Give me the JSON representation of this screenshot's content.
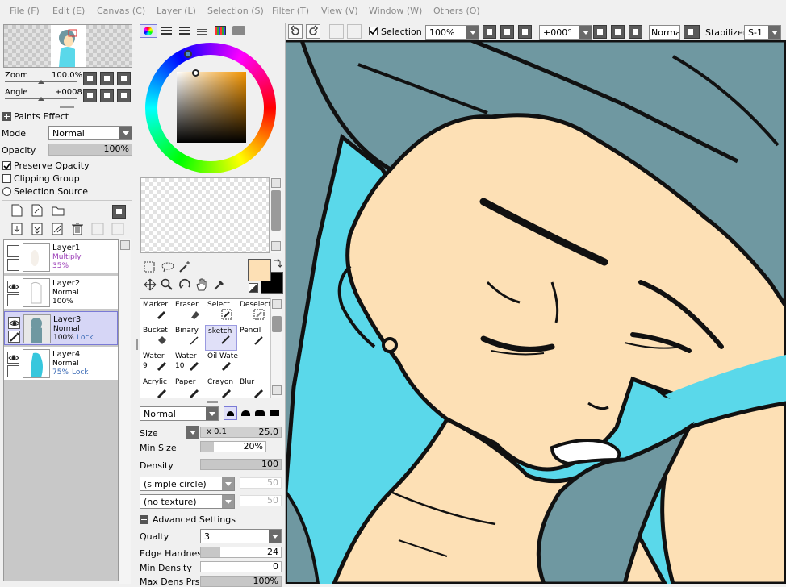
{
  "menu": [
    "File (F)",
    "Edit (E)",
    "Canvas (C)",
    "Layer (L)",
    "Selection (S)",
    "Filter (T)",
    "View (V)",
    "Window (W)",
    "Others (O)"
  ],
  "toolbar": {
    "selection_label": "Selection",
    "selection_checked": true,
    "zoom_value": "100%",
    "angle_value": "+000°",
    "blend_label": "Normal",
    "stabilizer_label": "Stabilizer",
    "stabilizer_value": "S-1"
  },
  "navigator": {
    "zoom_label": "Zoom",
    "zoom_value": "100.0%",
    "angle_label": "Angle",
    "angle_value": "+0008"
  },
  "layer_panel": {
    "paints_effect": "Paints Effect",
    "mode_label": "Mode",
    "mode_value": "Normal",
    "opacity_label": "Opacity",
    "opacity_value": "100%",
    "preserve_opacity": "Preserve Opacity",
    "clipping_group": "Clipping Group",
    "selection_source": "Selection Source",
    "layers": [
      {
        "name": "Layer1",
        "mode": "Multiply",
        "opacity": "35%",
        "lock": "",
        "visible": false,
        "selected": false
      },
      {
        "name": "Layer2",
        "mode": "Normal",
        "opacity": "100%",
        "lock": "",
        "visible": true,
        "selected": false
      },
      {
        "name": "Layer3",
        "mode": "Normal",
        "opacity": "100%",
        "lock": "Lock",
        "visible": true,
        "selected": true
      },
      {
        "name": "Layer4",
        "mode": "Normal",
        "opacity": "75%",
        "lock": "Lock",
        "visible": true,
        "selected": false
      }
    ]
  },
  "colors": {
    "primary": "#fde0b5",
    "secondary": "#000000",
    "canvas_hair": "#6f98a1",
    "canvas_skin": "#fde0b5",
    "canvas_bg": "#5ad8ea"
  },
  "tools": [
    {
      "name": "Marker",
      "num": ""
    },
    {
      "name": "Eraser",
      "num": ""
    },
    {
      "name": "Select",
      "num": ""
    },
    {
      "name": "Deselect",
      "num": ""
    },
    {
      "name": "Bucket",
      "num": ""
    },
    {
      "name": "Binary",
      "num": ""
    },
    {
      "name": "sketch",
      "num": ""
    },
    {
      "name": "Pencil",
      "num": ""
    },
    {
      "name": "Water",
      "num": "9"
    },
    {
      "name": "Water",
      "num": "10"
    },
    {
      "name": "Oil Wate",
      "num": ""
    },
    {
      "name": "",
      "num": ""
    },
    {
      "name": "Acrylic",
      "num": ""
    },
    {
      "name": "Paper",
      "num": ""
    },
    {
      "name": "Crayon",
      "num": ""
    },
    {
      "name": "Blur",
      "num": ""
    }
  ],
  "brush": {
    "blend": "Normal",
    "size_label": "Size",
    "size_mult": "x 0.1",
    "size_value": "25.0",
    "min_size_label": "Min Size",
    "min_size_value": "20%",
    "min_size_level": 0.2,
    "density_label": "Density",
    "density_value": "100",
    "density_level": 1.0,
    "shape": "(simple circle)",
    "shape_value": "50",
    "texture": "(no texture)",
    "texture_value": "50",
    "advanced_label": "Advanced Settings",
    "quality_label": "Qualty",
    "quality_value": "3",
    "edge_label": "Edge Hardness",
    "edge_value": "24",
    "edge_level": 0.24,
    "min_density_label": "Min Density",
    "min_density_value": "0",
    "max_dens_label": "Max Dens Prs",
    "max_dens_value": "100%"
  }
}
